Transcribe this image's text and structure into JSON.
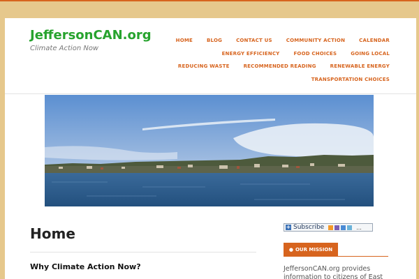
{
  "site": {
    "title": "JeffersonCAN.org",
    "tagline": "Climate Action Now"
  },
  "nav": {
    "rows": [
      [
        "HOME",
        "BLOG",
        "CONTACT US",
        "COMMUNITY ACTION",
        "CALENDAR"
      ],
      [
        "ENERGY EFFICIENCY",
        "FOOD CHOICES",
        "GOING LOCAL"
      ],
      [
        "REDUCING WASTE",
        "RECOMMENDED READING",
        "RENEWABLE ENERGY"
      ],
      [
        "TRANSPORTATION CHOICES"
      ]
    ]
  },
  "content": {
    "page_title": "Home",
    "section_heading": "Why Climate Action Now?"
  },
  "sidebar": {
    "subscribe_label": "Subscribe",
    "subscribe_more": "...",
    "widget_title": "OUR MISSION",
    "widget_text": "JeffersonCAN.org provides information to citizens of East"
  },
  "colors": {
    "accent": "#d7641e",
    "title_green": "#27a32e",
    "background": "#e6c88c"
  }
}
